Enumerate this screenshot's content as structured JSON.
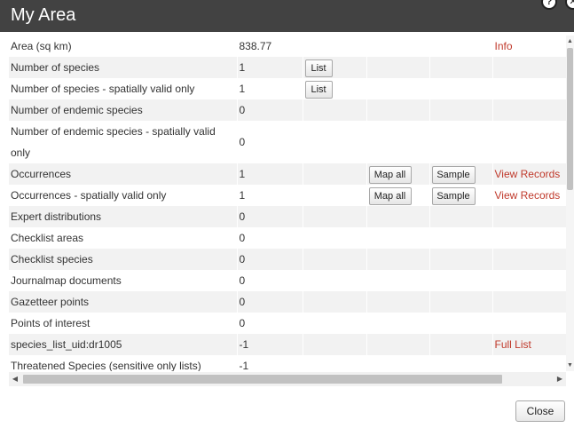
{
  "dialog": {
    "title": "My Area",
    "help_glyph": "?",
    "close_glyph": "✕",
    "close_label": "Close"
  },
  "rows": [
    {
      "label": "Area (sq km)",
      "value": "838.77",
      "link": "Info"
    },
    {
      "label": "Number of species",
      "value": "1",
      "list_button": "List"
    },
    {
      "label": "Number of species - spatially valid only",
      "value": "1",
      "list_button": "List"
    },
    {
      "label": "Number of endemic species",
      "value": "0"
    },
    {
      "label": "Number of endemic species - spatially valid only",
      "value": "0"
    },
    {
      "label": "Occurrences",
      "value": "1",
      "map_button": "Map all",
      "sample_button": "Sample",
      "link": "View Records"
    },
    {
      "label": "Occurrences - spatially valid only",
      "value": "1",
      "map_button": "Map all",
      "sample_button": "Sample",
      "link": "View Records"
    },
    {
      "label": "Expert distributions",
      "value": "0"
    },
    {
      "label": "Checklist areas",
      "value": "0"
    },
    {
      "label": "Checklist species",
      "value": "0"
    },
    {
      "label": "Journalmap documents",
      "value": "0"
    },
    {
      "label": "Gazetteer points",
      "value": "0"
    },
    {
      "label": "Points of interest",
      "value": "0"
    },
    {
      "label": "species_list_uid:dr1005",
      "value": "-1",
      "link": "Full List"
    },
    {
      "label": "Threatened Species (sensitive only lists)",
      "value": "-1"
    }
  ],
  "colors": {
    "titlebar": "#424242",
    "link": "#c0392b",
    "row_alt": "#f2f2f2"
  },
  "icons": {
    "help": "help-icon",
    "close": "close-icon",
    "scroll_up": "arrow-up-icon",
    "scroll_down": "arrow-down-icon",
    "scroll_left": "arrow-left-icon",
    "scroll_right": "arrow-right-icon"
  }
}
